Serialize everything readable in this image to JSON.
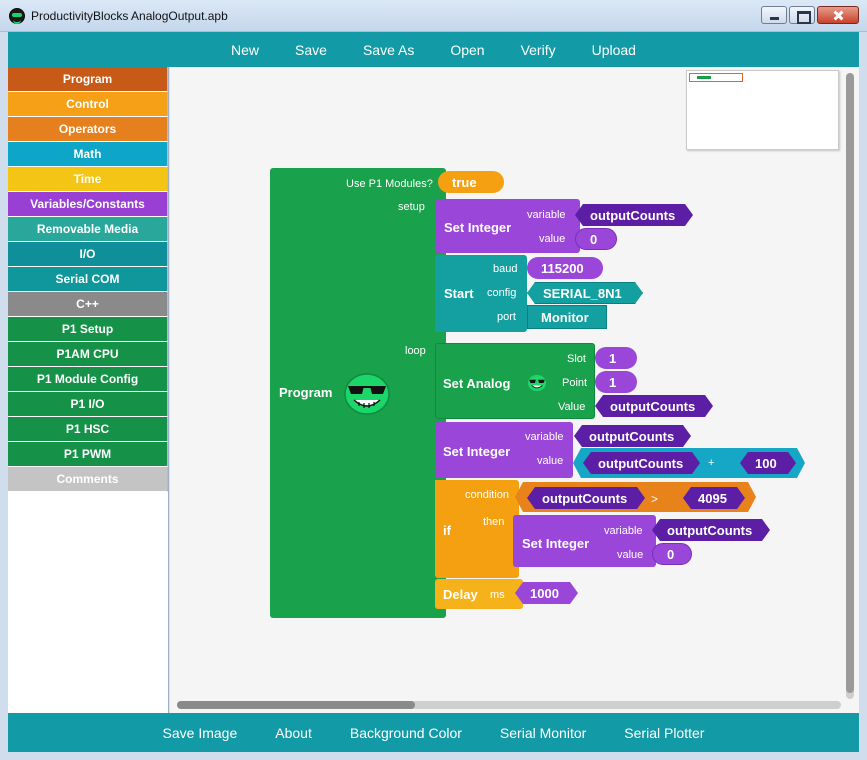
{
  "window": {
    "title": "ProductivityBlocks AnalogOutput.apb"
  },
  "toolbar": {
    "items": [
      "New",
      "Save",
      "Save As",
      "Open",
      "Verify",
      "Upload"
    ]
  },
  "sidebar": {
    "categories": [
      {
        "label": "Program",
        "color": "#c85a17"
      },
      {
        "label": "Control",
        "color": "#f5a017"
      },
      {
        "label": "Operators",
        "color": "#e6801f"
      },
      {
        "label": "Math",
        "color": "#0ea6c8"
      },
      {
        "label": "Time",
        "color": "#f5c515"
      },
      {
        "label": "Variables/Constants",
        "color": "#9a3fd4"
      },
      {
        "label": "Removable Media",
        "color": "#2aa79b"
      },
      {
        "label": "I/O",
        "color": "#0f8f9a"
      },
      {
        "label": "Serial COM",
        "color": "#0f979b"
      },
      {
        "label": "C++",
        "color": "#8a8a8a"
      },
      {
        "label": "P1 Setup",
        "color": "#159148"
      },
      {
        "label": "P1AM CPU",
        "color": "#159148"
      },
      {
        "label": "P1 Module Config",
        "color": "#159148"
      },
      {
        "label": "P1 I/O",
        "color": "#159148"
      },
      {
        "label": "P1 HSC",
        "color": "#159148"
      },
      {
        "label": "P1 PWM",
        "color": "#159148"
      },
      {
        "label": "Comments",
        "color": "#c4c4c4"
      }
    ]
  },
  "blocks": {
    "program": {
      "label": "Program",
      "use_p1_label": "Use P1 Modules?",
      "use_p1_value": "true",
      "setup_label": "setup",
      "loop_label": "loop"
    },
    "set_integer_setup": {
      "label": "Set Integer",
      "variable_label": "variable",
      "variable_value": "outputCounts",
      "value_label": "value",
      "value_value": "0"
    },
    "start": {
      "label": "Start",
      "baud_label": "baud",
      "baud_value": "115200",
      "config_label": "config",
      "config_value": "SERIAL_8N1",
      "port_label": "port",
      "port_value": "Monitor"
    },
    "set_analog": {
      "label": "Set Analog",
      "slot_label": "Slot",
      "slot_value": "1",
      "point_label": "Point",
      "point_value": "1",
      "value_label": "Value",
      "value_value": "outputCounts"
    },
    "set_integer_loop": {
      "label": "Set Integer",
      "variable_label": "variable",
      "variable_value": "outputCounts",
      "value_label": "value",
      "expr_left": "outputCounts",
      "expr_op": "+",
      "expr_right": "100"
    },
    "if": {
      "label": "if",
      "condition_label": "condition",
      "cond_left": "outputCounts",
      "cond_op": ">",
      "cond_right": "4095",
      "then_label": "then"
    },
    "set_integer_then": {
      "label": "Set Integer",
      "variable_label": "variable",
      "variable_value": "outputCounts",
      "value_label": "value",
      "value_value": "0"
    },
    "delay": {
      "label": "Delay",
      "ms_label": "ms",
      "ms_value": "1000"
    }
  },
  "bottombar": {
    "items": [
      "Save Image",
      "About",
      "Background Color",
      "Serial Monitor",
      "Serial Plotter"
    ]
  }
}
